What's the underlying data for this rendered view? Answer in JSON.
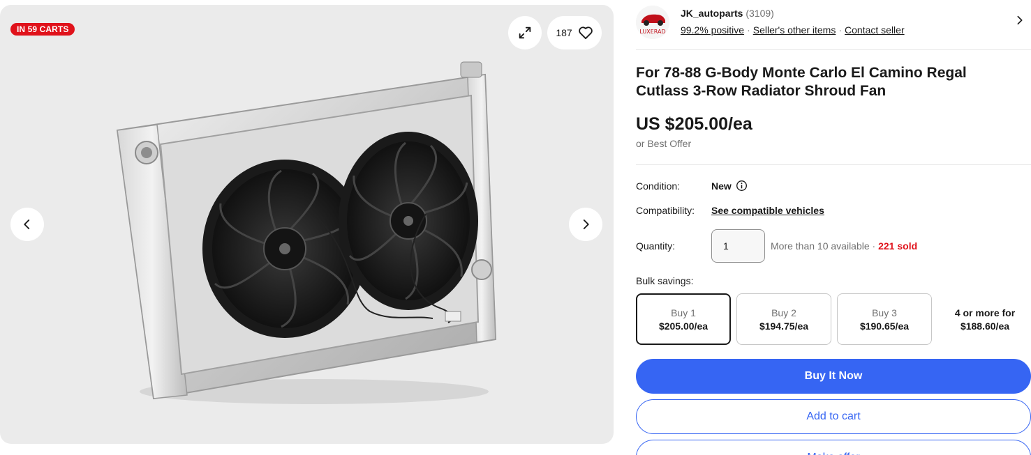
{
  "gallery": {
    "badge": "IN 59 CARTS",
    "watch_count": "187",
    "icons": {
      "expand": "expand-icon",
      "heart": "heart-icon",
      "prev": "chevron-left-icon",
      "next": "chevron-right-icon"
    },
    "image_alt": "radiator with twin fans"
  },
  "seller": {
    "name": "JK_autoparts",
    "feedback_count": "(3109)",
    "positive": "99.2% positive",
    "other_items": "Seller's other items",
    "contact": "Contact seller",
    "logo_text": "LUXERAD"
  },
  "listing": {
    "title": "For 78-88 G-Body Monte Carlo El Camino Regal Cutlass 3-Row Radiator Shroud Fan",
    "price": "US $205.00/ea",
    "best_offer": "or Best Offer"
  },
  "details": {
    "condition_label": "Condition:",
    "condition_value": "New",
    "compat_label": "Compatibility:",
    "compat_link": "See compatible vehicles",
    "quantity_label": "Quantity:",
    "quantity_value": "1",
    "availability": "More than 10 available",
    "separator": " · ",
    "sold": "221 sold"
  },
  "bulk": {
    "label": "Bulk savings:",
    "options": [
      {
        "qty": "Buy 1",
        "price": "$205.00/ea",
        "selected": true
      },
      {
        "qty": "Buy 2",
        "price": "$194.75/ea",
        "selected": false
      },
      {
        "qty": "Buy 3",
        "price": "$190.65/ea",
        "selected": false
      },
      {
        "qty": "4 or more for",
        "price": "$188.60/ea",
        "selected": false
      }
    ]
  },
  "actions": {
    "buy_now": "Buy It Now",
    "add_to_cart": "Add to cart",
    "make_offer": "Make offer"
  },
  "colors": {
    "badge_red": "#e0121b",
    "primary_blue": "#3665f3",
    "sold_red": "#e0121b"
  }
}
